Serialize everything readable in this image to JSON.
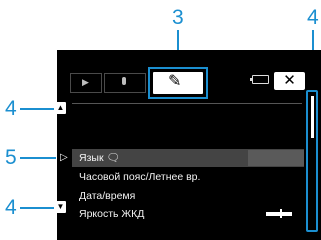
{
  "callouts": {
    "top": "3",
    "top_right": "4",
    "up_arrow": "4",
    "selected_item": "5",
    "down_arrow": "4"
  },
  "tabs": [
    {
      "icon": "play-icon",
      "glyph": "▶"
    },
    {
      "icon": "microphone-icon",
      "glyph": "🎙"
    },
    {
      "icon": "wrench-icon",
      "glyph": "🔧",
      "active": true
    },
    {
      "icon": "battery-icon"
    }
  ],
  "close_button": {
    "label": "✕"
  },
  "menu": {
    "items": [
      {
        "label": "Язык 🗨",
        "selected": true
      },
      {
        "label": "Часовой пояс/Летнее вр."
      },
      {
        "label": "Дата/время"
      },
      {
        "label": "Яркость ЖКД"
      }
    ],
    "lcd_brightness_level": 0.55
  },
  "scroll": {
    "up_glyph": "▲",
    "down_glyph": "▼"
  },
  "colors": {
    "accent": "#1b8fd0",
    "screen_bg": "#000000"
  }
}
